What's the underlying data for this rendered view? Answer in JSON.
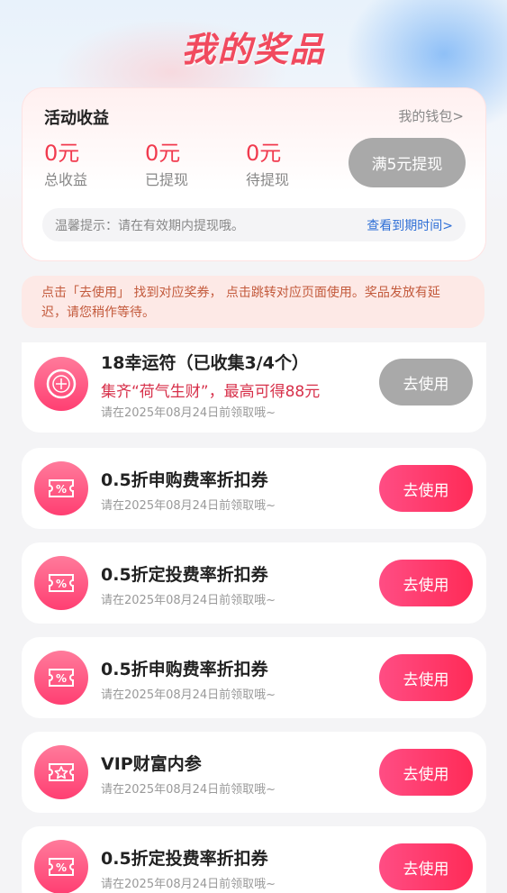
{
  "header": {
    "title": "我的奖品"
  },
  "earnings": {
    "title": "活动收益",
    "wallet_link": "我的钱包>",
    "stats": [
      {
        "value": "0元",
        "label": "总收益"
      },
      {
        "value": "0元",
        "label": "已提现"
      },
      {
        "value": "0元",
        "label": "待提现"
      }
    ],
    "withdraw_label": "满5元提现",
    "tip_text": "温馨提示：请在有效期内提现哦。",
    "tip_link": "查看到期时间>"
  },
  "notice": "点击「去使用」 找到对应奖券， 点击跳转对应页面使用。奖品发放有延迟，请您稍作等待。",
  "prizes": [
    {
      "icon": "lucky-charm-icon",
      "name": "18幸运符（已收集3/4个）",
      "sub": "集齐“荷气生财”，最高可得88元",
      "date": "请在2025年08月24日前领取哦~",
      "button": "去使用",
      "enabled": false
    },
    {
      "icon": "discount-ticket-icon",
      "name": "0.5折申购费率折扣券",
      "date": "请在2025年08月24日前领取哦~",
      "button": "去使用",
      "enabled": true
    },
    {
      "icon": "discount-ticket-icon",
      "name": "0.5折定投费率折扣券",
      "date": "请在2025年08月24日前领取哦~",
      "button": "去使用",
      "enabled": true
    },
    {
      "icon": "discount-ticket-icon",
      "name": "0.5折申购费率折扣券",
      "date": "请在2025年08月24日前领取哦~",
      "button": "去使用",
      "enabled": true
    },
    {
      "icon": "vip-star-ticket-icon",
      "name": "VIP财富内参",
      "date": "请在2025年08月24日前领取哦~",
      "button": "去使用",
      "enabled": true
    },
    {
      "icon": "discount-ticket-icon",
      "name": "0.5折定投费率折扣券",
      "date": "请在2025年08月24日前领取哦~",
      "button": "去使用",
      "enabled": true
    }
  ]
}
